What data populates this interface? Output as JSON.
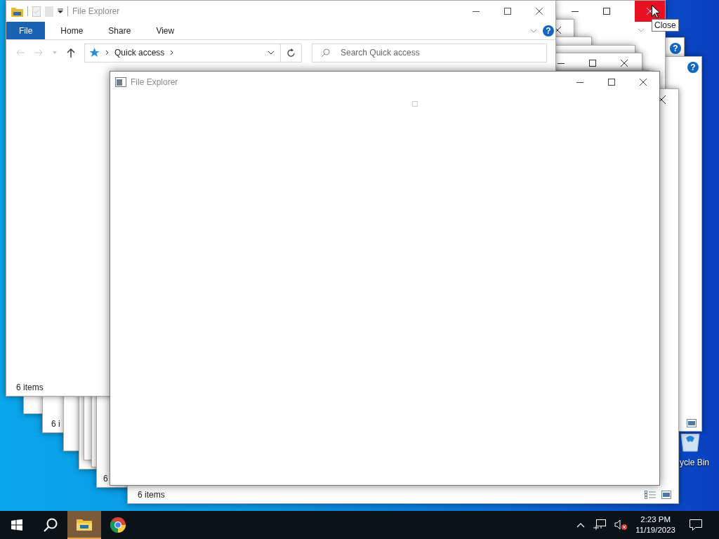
{
  "desktop_icons": [
    {
      "label": "ycle Bin"
    }
  ],
  "right_windows": [
    {
      "help": "?",
      "view_icons": false
    },
    {
      "help": "?",
      "view_icons": true
    }
  ],
  "back_window": {
    "close_hovered": true,
    "tooltip": "Close"
  },
  "stacked_statuses": [
    "6 i",
    "6"
  ],
  "bottom_window": {
    "status": "6 items"
  },
  "explorer_window": {
    "title": "File Explorer",
    "help": "?",
    "ribbon_tabs": [
      {
        "label": "File",
        "selected": true
      },
      {
        "label": "Home",
        "selected": false
      },
      {
        "label": "Share",
        "selected": false
      },
      {
        "label": "View",
        "selected": false
      }
    ],
    "address": "Quick access",
    "search": {
      "placeholder": "Search Quick access"
    },
    "status": "6 items"
  },
  "front_window": {
    "title": "File Explorer"
  },
  "taskbar": {
    "apps": [
      {
        "kind": "file-explorer",
        "active": true
      },
      {
        "kind": "chrome",
        "active": false
      }
    ],
    "time": "2:23 PM",
    "date": "11/19/2023"
  }
}
